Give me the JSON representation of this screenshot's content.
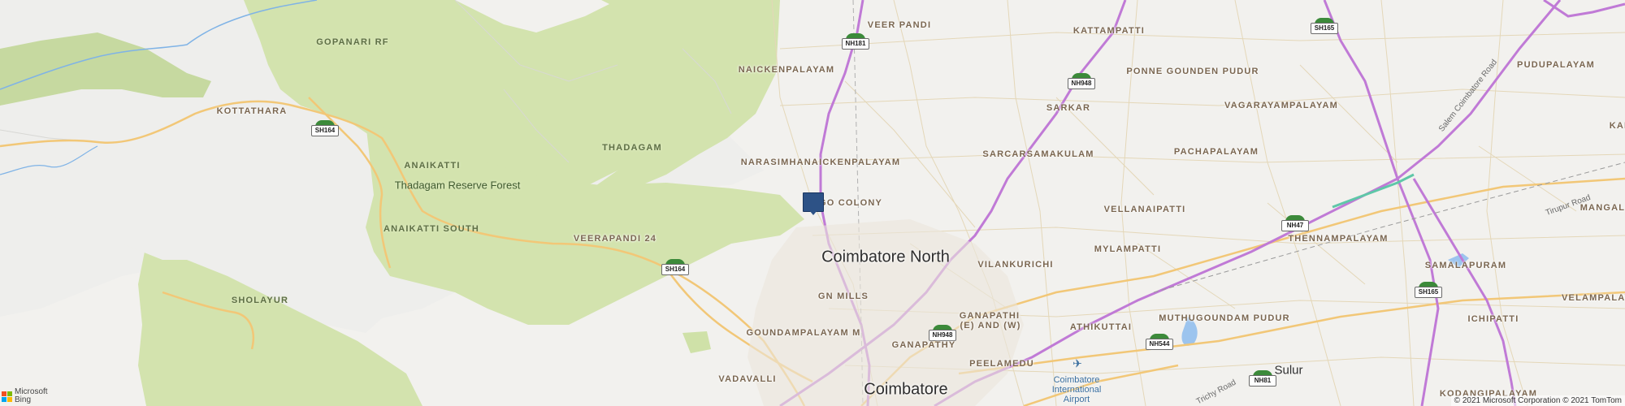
{
  "map": {
    "attribution": "© 2021 Microsoft Corporation © 2021 TomTom",
    "logo": {
      "line1": "Microsoft",
      "line2": "Bing",
      "colors": [
        "#f25022",
        "#7fba00",
        "#00a4ef",
        "#ffb900"
      ]
    },
    "pin": {
      "icon": "location-pin-icon",
      "color": "#2d5286"
    },
    "colors": {
      "land": "#f2f1ee",
      "forest": "#d3e3ae",
      "hills": "#bdd49a",
      "highway": "#c07ad6",
      "state_road": "#f2c777",
      "water": "#7fb3e6"
    }
  },
  "places": {
    "veer_pandi": "VEER PANDI",
    "kattampatti": "KATTAMPATTI",
    "gopanari_rf": "GOPANARI RF",
    "naickenpalayam": "NAICKENPALAYAM",
    "ponne_gounden_pudur": "PONNE GOUNDEN PUDUR",
    "pudupalayam": "PUDUPALAYAM",
    "kottathara": "KOTTATHARA",
    "sarkar": "SARKAR",
    "vagarayampalayam": "VAGARAYAMPALAYAM",
    "thadagam": "THADAGAM",
    "narasimhanaickenpalayam": "NARASIMHANAICKENPALAYAM",
    "sarcarsamakulam": "SARCARSAMAKULAM",
    "pachapalayam": "PACHAPALAYAM",
    "anaikatti": "ANAIKATTI",
    "go_colony": "GO COLONY",
    "vellanaipatti": "VELLANAIPATTI",
    "mangala": "MANGALA",
    "anaikatti_south": "ANAIKATTI SOUTH",
    "veerapandi_24": "VEERAPANDI 24",
    "thennampalayam": "THENNAMPALAYAM",
    "mylampatti": "MYLAMPATTI",
    "vilankurichi": "VILANKURICHI",
    "samalapuram": "SAMALAPURAM",
    "velampalay": "VELAMPALAY",
    "sholayur": "SHOLAYUR",
    "gn_mills": "GN MILLS",
    "goundampalayam": "GOUNDAMPALAYAM M",
    "ganapathi_e_w": "GANAPATHI",
    "ganapathi_e_w_2": "(E) AND (W)",
    "ganapathy": "GANAPATHY",
    "athikuttai": "ATHIKUTTAI",
    "muthugoundam_pudur": "MUTHUGOUNDAM PUDUR",
    "ichipatti": "ICHIPATTI",
    "peelamedu": "PEELAMEDU",
    "vadavalli": "VADAVALLI",
    "kodangipalayam": "KODANGIPALAYAM",
    "kai": "KAI",
    "thadagam_reserve_forest": "Thadagam Reserve Forest",
    "coimbatore_north": "Coimbatore North",
    "coimbatore": "Coimbatore",
    "sulur": "Sulur",
    "airport_line1": "Coimbatore",
    "airport_line2": "International",
    "airport_line3": "Airport"
  },
  "roads": {
    "salem_coimbatore_road": "Salem Coimbatore Road",
    "tirupur_road": "Tirupur Road",
    "trichy_road": "Trichy Road"
  },
  "shields": {
    "nh181": "NH181",
    "sh165_top": "SH165",
    "nh948_top": "NH948",
    "sh164_left": "SH164",
    "nh47": "NH47",
    "sh164_mid": "SH164",
    "sh165_right": "SH165",
    "nh948_bottom": "NH948",
    "nh544": "NH544",
    "nh81": "NH81"
  }
}
